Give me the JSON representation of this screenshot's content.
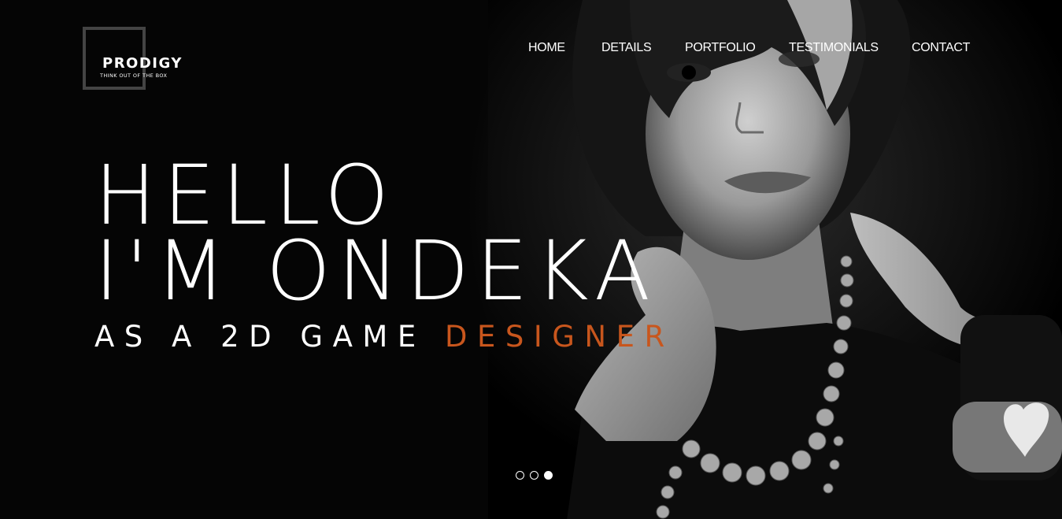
{
  "logo": {
    "title": "PRODIGY",
    "tagline": "THINK OUT OF THE BOX"
  },
  "nav": {
    "items": [
      "HOME",
      "DETAILS",
      "PORTFOLIO",
      "TESTIMONIALS",
      "CONTACT"
    ]
  },
  "hero": {
    "line1": "HELLO",
    "line2": "I'M ONDEKA",
    "subtitle_prefix": "AS A 2D GAME ",
    "subtitle_accent": "DESIGNER",
    "accent_color": "#c8561d",
    "image": "black-and-white-portrait"
  },
  "slider": {
    "count": 3,
    "active_index": 2
  }
}
